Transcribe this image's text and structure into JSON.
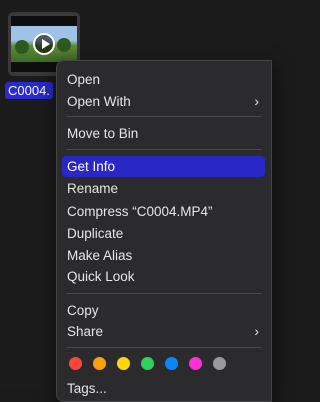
{
  "file": {
    "name": "C0004.",
    "thumbnail_icon": "video-thumbnail-icon",
    "play_icon": "play-icon"
  },
  "menu": {
    "items": [
      {
        "label": "Open"
      },
      {
        "label": "Open With",
        "submenu": true
      },
      {
        "label": "Move to Bin"
      },
      {
        "label": "Get Info",
        "selected": true
      },
      {
        "label": "Rename"
      },
      {
        "label": "Compress “C0004.MP4”"
      },
      {
        "label": "Duplicate"
      },
      {
        "label": "Make Alias"
      },
      {
        "label": "Quick Look"
      },
      {
        "label": "Copy"
      },
      {
        "label": "Share",
        "submenu": true
      }
    ],
    "submenu_chevron": "›",
    "tag_colors": [
      "#ff453a",
      "#ff9f0a",
      "#ffd60a",
      "#30d158",
      "#0a84ff",
      "#ff2fd8",
      "#9a9a9c"
    ],
    "tags_label": "Tags...",
    "selected_color": "#2a27c7"
  }
}
